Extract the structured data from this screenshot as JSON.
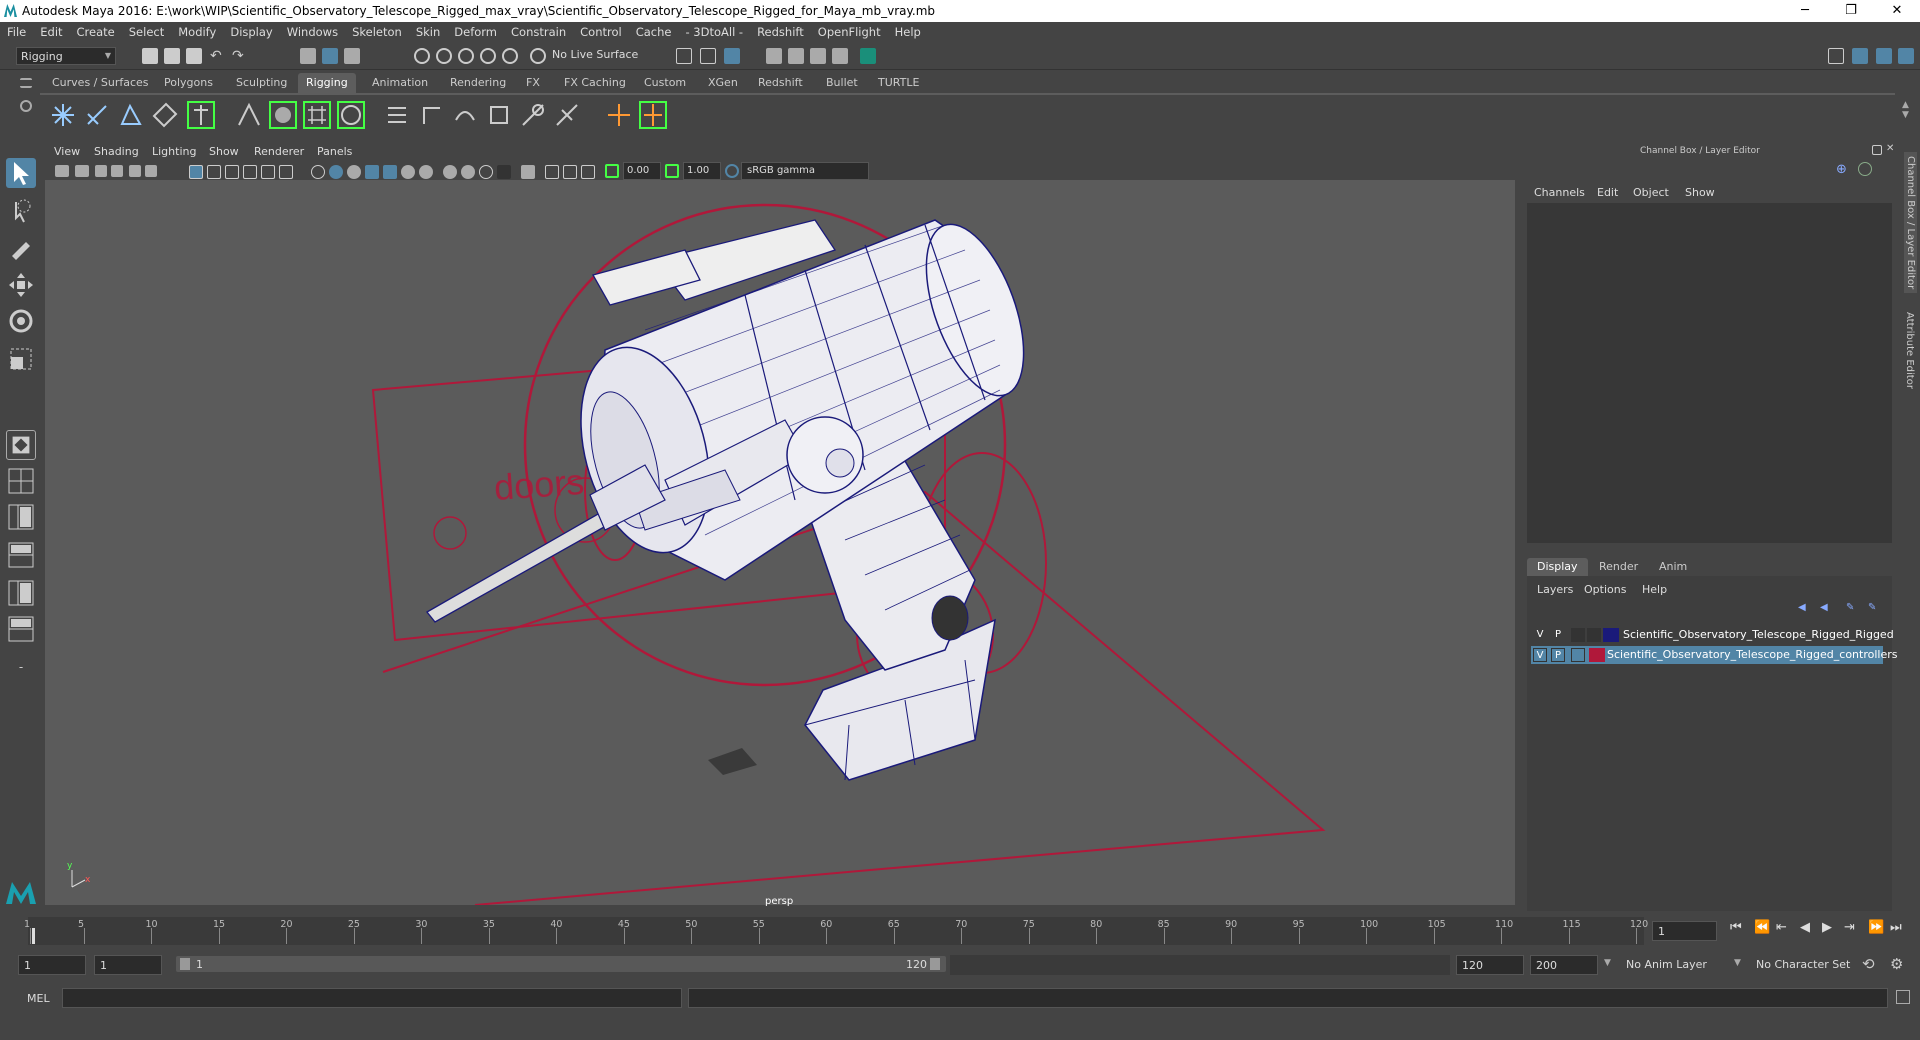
{
  "window": {
    "title": "Autodesk Maya 2016: E:\\work\\WIP\\Scientific_Observatory_Telescope_Rigged_max_vray\\Scientific_Observatory_Telescope_Rigged_for_Maya_mb_vray.mb",
    "minimize": "─",
    "restore": "❐",
    "close": "✕"
  },
  "menubar": [
    "File",
    "Edit",
    "Create",
    "Select",
    "Modify",
    "Display",
    "Windows",
    "Skeleton",
    "Skin",
    "Deform",
    "Constrain",
    "Control",
    "Cache",
    "- 3DtoAll -",
    "Redshift",
    "OpenFlight",
    "Help"
  ],
  "statusline": {
    "mode": "Rigging",
    "live_surface": "No Live Surface"
  },
  "shelf_tabs": [
    "Curves / Surfaces",
    "Polygons",
    "Sculpting",
    "Rigging",
    "Animation",
    "Rendering",
    "FX",
    "FX Caching",
    "Custom",
    "XGen",
    "Redshift",
    "Bullet",
    "TURTLE"
  ],
  "active_shelf": "Rigging",
  "viewport": {
    "menus": [
      "View",
      "Shading",
      "Lighting",
      "Show",
      "Renderer",
      "Panels"
    ],
    "exposure": "0.00",
    "gamma": "1.00",
    "color_space": "sRGB gamma",
    "camera_label": "persp",
    "scene_text": "doors"
  },
  "channel_box": {
    "title": "Channel Box / Layer Editor",
    "menus": [
      "Channels",
      "Edit",
      "Object",
      "Show"
    ]
  },
  "layer_editor": {
    "tabs": [
      "Display",
      "Render",
      "Anim"
    ],
    "active_tab": "Display",
    "menus": [
      "Layers",
      "Options",
      "Help"
    ],
    "layers": [
      {
        "v": "V",
        "p": "P",
        "name": "Scientific_Observatory_Telescope_Rigged_Rigged",
        "color": "#1a1a7a",
        "selected": false
      },
      {
        "v": "V",
        "p": "P",
        "name": "Scientific_Observatory_Telescope_Rigged_controllers",
        "color": "#b0183a",
        "selected": true
      }
    ]
  },
  "side_tabs": [
    "Channel Box / Layer Editor",
    "Attribute Editor"
  ],
  "timeline": {
    "ticks": [
      "1",
      "5",
      "10",
      "15",
      "20",
      "25",
      "30",
      "35",
      "40",
      "45",
      "50",
      "55",
      "60",
      "65",
      "70",
      "75",
      "80",
      "85",
      "90",
      "95",
      "100",
      "105",
      "110",
      "115",
      "120"
    ],
    "current_frame": "1"
  },
  "range": {
    "start": "1",
    "playback_start": "1",
    "slider_start": "1",
    "slider_end": "120",
    "playback_end": "120",
    "end": "200",
    "anim_layer": "No Anim Layer",
    "character_set": "No Character Set"
  },
  "command_line": {
    "label": "MEL"
  },
  "colors": {
    "accent": "#5285a6",
    "controller_red": "#b0183a",
    "wire_blue": "#1a1a7a"
  }
}
